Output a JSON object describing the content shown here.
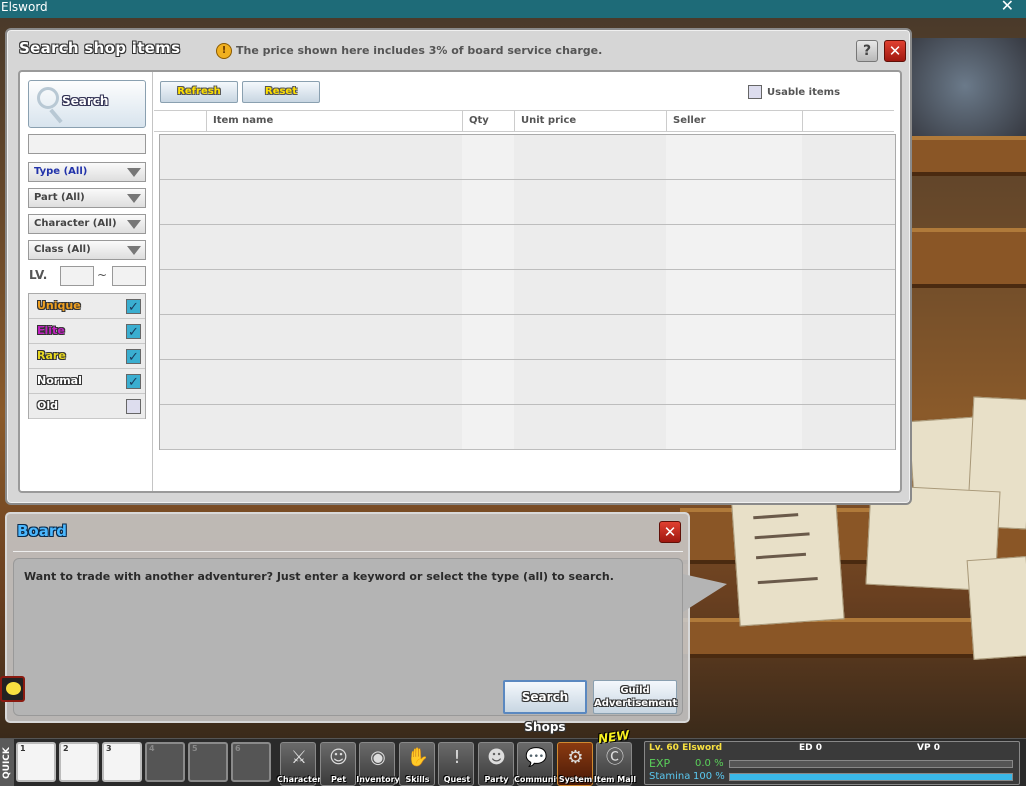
{
  "window": {
    "title": "Elsword",
    "close_glyph": "✕"
  },
  "search_window": {
    "title": "Search shop items",
    "notice": "The price shown here includes 3% of board service charge.",
    "help_glyph": "?",
    "close_glyph": "✕",
    "filters": {
      "search_label": "Search",
      "keyword_value": "",
      "dropdowns": [
        "Type (All)",
        "Part (All)",
        "Character (All)",
        "Class (All)"
      ],
      "level_label": "LV.",
      "level_sep": "~",
      "level_min": "",
      "level_max": "",
      "grades": [
        {
          "label": "Unique",
          "color": "#f0a020",
          "checked": true
        },
        {
          "label": "Elite",
          "color": "#c020c0",
          "checked": true
        },
        {
          "label": "Rare",
          "color": "#e8d820",
          "checked": true
        },
        {
          "label": "Normal",
          "color": "#ffffff",
          "checked": true
        },
        {
          "label": "Old",
          "color": "#ffffff",
          "checked": false
        }
      ]
    },
    "results": {
      "refresh_label": "Refresh",
      "reset_label": "Reset",
      "usable_label": "Usable items",
      "usable_checked": false,
      "columns": [
        "Item name",
        "Qty",
        "Unit price",
        "Seller"
      ],
      "rows": [
        "",
        "",
        "",
        "",
        "",
        "",
        ""
      ]
    }
  },
  "board": {
    "title": "Board",
    "close_glyph": "✕",
    "message": "Want to trade with another adventurer? Just enter a keyword or select the type (all) to search.",
    "search_shops_label": "Search Shops",
    "guild_label_1": "Guild",
    "guild_label_2": "Advertisement"
  },
  "bottom_bar": {
    "quick_label": "QUICK",
    "slots": [
      "1",
      "2",
      "3",
      "4",
      "5",
      "6"
    ],
    "menu": [
      {
        "label": "Character",
        "icon": "character-icon",
        "glyph": "⚔"
      },
      {
        "label": "Pet",
        "icon": "pet-icon",
        "glyph": "☺"
      },
      {
        "label": "Inventory",
        "icon": "inventory-icon",
        "glyph": "◉"
      },
      {
        "label": "Skills",
        "icon": "skills-icon",
        "glyph": "✋"
      },
      {
        "label": "Quest",
        "icon": "quest-icon",
        "glyph": "!"
      },
      {
        "label": "Party",
        "icon": "party-icon",
        "glyph": "☻"
      },
      {
        "label": "Community",
        "icon": "community-icon",
        "glyph": "💬"
      },
      {
        "label": "System",
        "icon": "gear-icon",
        "glyph": "⚙"
      },
      {
        "label": "Item Mall",
        "icon": "item-mall-icon",
        "glyph": "Ⓒ"
      }
    ],
    "new_tag": "NEW",
    "status": {
      "level": "Lv. 60",
      "name": "Elsword",
      "ed_label": "ED",
      "ed_value": "0",
      "vp_label": "VP",
      "vp_value": "0",
      "exp_label": "EXP",
      "exp_value": "0.0 %",
      "exp_fraction": 0.0,
      "stamina_label": "Stamina",
      "stamina_value": "100 %",
      "stamina_fraction": 1.0
    }
  }
}
